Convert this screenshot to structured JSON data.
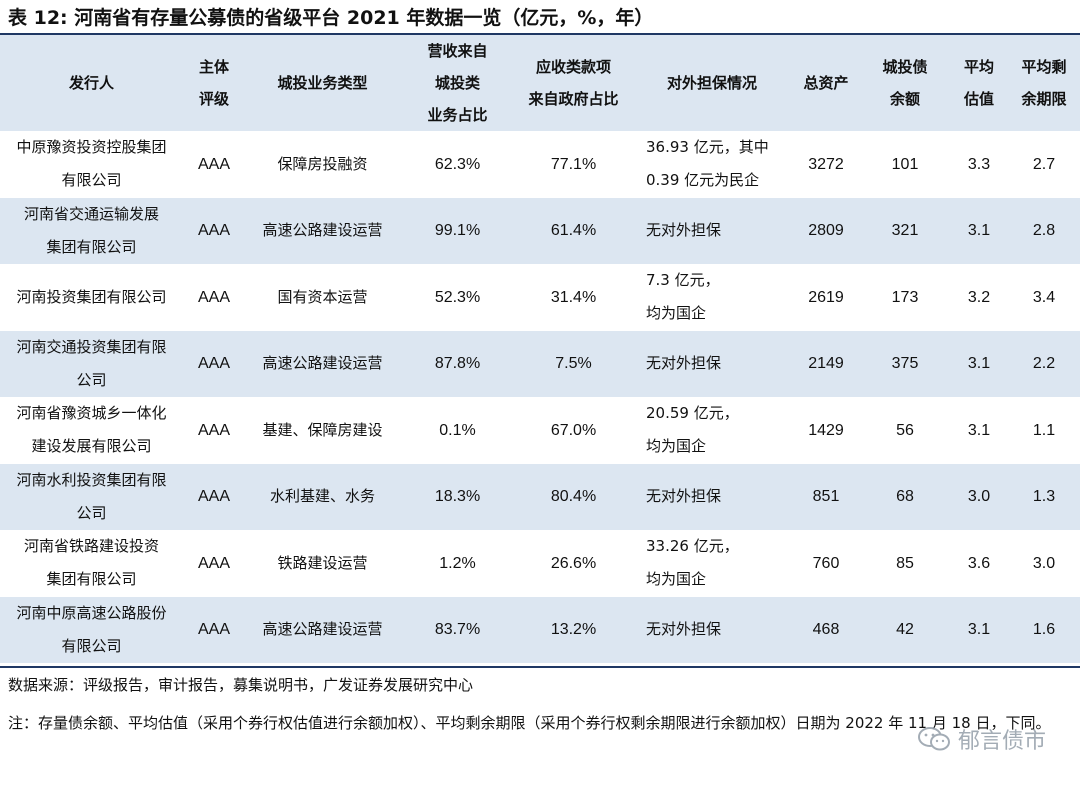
{
  "title": "表 12:  河南省有存量公募债的省级平台 2021 年数据一览（亿元，%，年）",
  "headers": [
    "发行人",
    "主体\n评级",
    "城投业务类型",
    "营收来自\n城投类\n业务占比",
    "应收类款项\n来自政府占比",
    "对外担保情况",
    "总资产",
    "城投债\n余额",
    "平均\n估值",
    "平均剩\n余期限"
  ],
  "rows": [
    [
      "中原豫资投资控股集团\n有限公司",
      "AAA",
      "保障房投融资",
      "62.3%",
      "77.1%",
      "36.93 亿元，其中\n0.39 亿元为民企",
      "3272",
      "101",
      "3.3",
      "2.7"
    ],
    [
      "河南省交通运输发展\n集团有限公司",
      "AAA",
      "高速公路建设运营",
      "99.1%",
      "61.4%",
      "无对外担保",
      "2809",
      "321",
      "3.1",
      "2.8"
    ],
    [
      "河南投资集团有限公司",
      "AAA",
      "国有资本运营",
      "52.3%",
      "31.4%",
      "7.3 亿元，\n均为国企",
      "2619",
      "173",
      "3.2",
      "3.4"
    ],
    [
      "河南交通投资集团有限\n公司",
      "AAA",
      "高速公路建设运营",
      "87.8%",
      "7.5%",
      "无对外担保",
      "2149",
      "375",
      "3.1",
      "2.2"
    ],
    [
      "河南省豫资城乡一体化\n建设发展有限公司",
      "AAA",
      "基建、保障房建设",
      "0.1%",
      "67.0%",
      "20.59 亿元，\n均为国企",
      "1429",
      "56",
      "3.1",
      "1.1"
    ],
    [
      "河南水利投资集团有限\n公司",
      "AAA",
      "水利基建、水务",
      "18.3%",
      "80.4%",
      "无对外担保",
      "851",
      "68",
      "3.0",
      "1.3"
    ],
    [
      "河南省铁路建设投资\n集团有限公司",
      "AAA",
      "铁路建设运营",
      "1.2%",
      "26.6%",
      "33.26 亿元，\n均为国企",
      "760",
      "85",
      "3.6",
      "3.0"
    ],
    [
      "河南中原高速公路股份\n有限公司",
      "AAA",
      "高速公路建设运营",
      "83.7%",
      "13.2%",
      "无对外担保",
      "468",
      "42",
      "3.1",
      "1.6"
    ]
  ],
  "source": "数据来源：评级报告，审计报告，募集说明书，广发证券发展研究中心",
  "note": "注：存量债余额、平均估值（采用个券行权估值进行余额加权）、平均剩余期限（采用个券行权剩余期限进行余额加权）日期为 2022 年 11 月 18 日，下同。",
  "watermark": "郁言债市",
  "colors": {
    "header_bg": "#dce6f1",
    "stripe_bg": "#dce6f1",
    "rule": "#1f3864"
  },
  "icons": {
    "watermark": "wechat-icon"
  }
}
